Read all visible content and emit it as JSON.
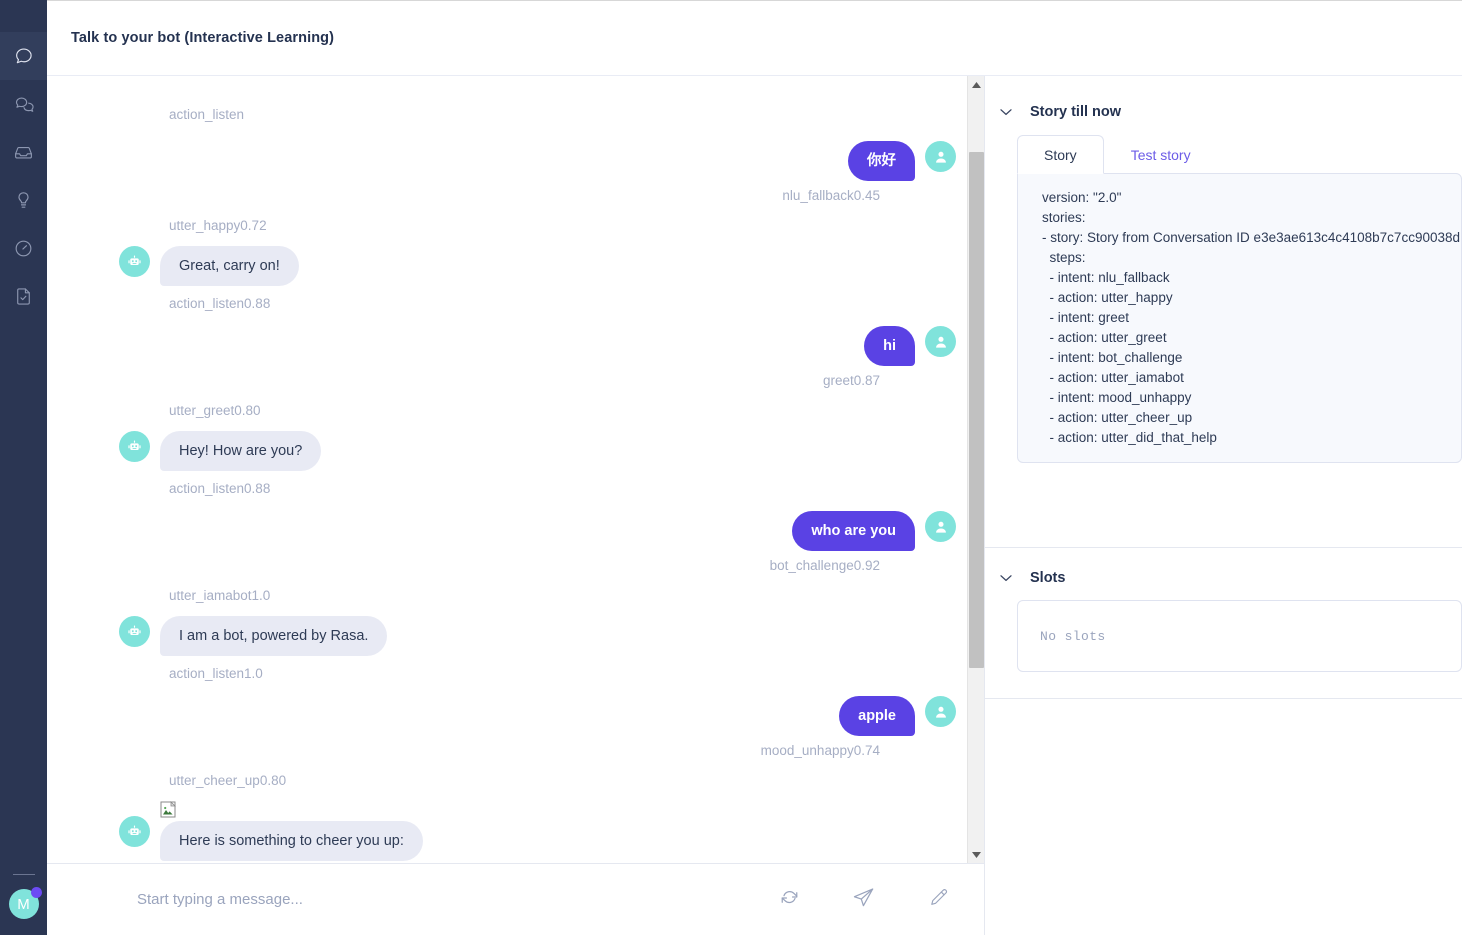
{
  "sidebar": {
    "items": [
      {
        "icon": "chat-bubble-icon",
        "name": "sidebar-item-talk-to-bot",
        "active": true
      },
      {
        "icon": "conversations-icon",
        "name": "sidebar-item-conversations",
        "active": false
      },
      {
        "icon": "inbox-icon",
        "name": "sidebar-item-inbox",
        "active": false
      },
      {
        "icon": "lightbulb-icon",
        "name": "sidebar-item-nlu-insights",
        "active": false
      },
      {
        "icon": "gauge-icon",
        "name": "sidebar-item-analytics",
        "active": false
      },
      {
        "icon": "document-check-icon",
        "name": "sidebar-item-training",
        "active": false
      }
    ],
    "avatar_initial": "M"
  },
  "header": {
    "title": "Talk to your bot (Interactive Learning)"
  },
  "chat": {
    "events": [
      {
        "type": "label",
        "align": "left",
        "text": "action_listen"
      },
      {
        "type": "message",
        "sender": "user",
        "text": "你好",
        "label": "nlu_fallback0.45"
      },
      {
        "type": "label",
        "align": "left",
        "text": "utter_happy0.72"
      },
      {
        "type": "message",
        "sender": "bot",
        "text": "Great, carry on!",
        "label": "action_listen0.88"
      },
      {
        "type": "message",
        "sender": "user",
        "text": "hi",
        "label": "greet0.87"
      },
      {
        "type": "label",
        "align": "left",
        "text": "utter_greet0.80"
      },
      {
        "type": "message",
        "sender": "bot",
        "text": "Hey! How are you?",
        "label": "action_listen0.88"
      },
      {
        "type": "message",
        "sender": "user",
        "text": "who are you",
        "label": "bot_challenge0.92"
      },
      {
        "type": "label",
        "align": "left",
        "text": "utter_iamabot1.0"
      },
      {
        "type": "message",
        "sender": "bot",
        "text": "I am a bot, powered by Rasa.",
        "label": "action_listen1.0"
      },
      {
        "type": "message",
        "sender": "user",
        "text": "apple",
        "label": "mood_unhappy0.74"
      },
      {
        "type": "label",
        "align": "left",
        "text": "utter_cheer_up0.80"
      },
      {
        "type": "message",
        "sender": "bot",
        "text": "Here is something to cheer you up:",
        "broken_image": true
      }
    ],
    "labels": {
      "action_listen": "action_listen",
      "nlu_fallback": "nlu_fallback0.45",
      "utter_happy": "utter_happy0.72",
      "action_listen_088_a": "action_listen0.88",
      "greet": "greet0.87",
      "utter_greet": "utter_greet0.80",
      "action_listen_088_b": "action_listen0.88",
      "bot_challenge": "bot_challenge0.92",
      "utter_iamabot": "utter_iamabot1.0",
      "action_listen_10": "action_listen1.0",
      "mood_unhappy": "mood_unhappy0.74",
      "utter_cheer_up": "utter_cheer_up0.80"
    },
    "messages": {
      "m1": "你好",
      "m2": "Great, carry on!",
      "m3": "hi",
      "m4": "Hey! How are you?",
      "m5": "who are you",
      "m6": "I am a bot, powered by Rasa.",
      "m7": "apple",
      "m8": "Here is something to cheer you up:"
    }
  },
  "composer": {
    "placeholder": "Start typing a message...",
    "value": "",
    "actions": [
      {
        "name": "restart-button",
        "icon": "refresh-icon"
      },
      {
        "name": "send-button",
        "icon": "send-icon"
      },
      {
        "name": "edit-button",
        "icon": "pencil-icon"
      }
    ]
  },
  "right_panel": {
    "story_section": {
      "title": "Story till now",
      "tabs": [
        {
          "label": "Story",
          "active": true
        },
        {
          "label": "Test story",
          "active": false
        }
      ],
      "story_lines": [
        "version: \"2.0\"",
        "stories:",
        "- story: Story from Conversation ID e3e3ae613c4c4108b7c7cc90038d",
        "  steps:",
        "  - intent: nlu_fallback",
        "  - action: utter_happy",
        "  - intent: greet",
        "  - action: utter_greet",
        "  - intent: bot_challenge",
        "  - action: utter_iamabot",
        "  - intent: mood_unhappy",
        "  - action: utter_cheer_up",
        "  - action: utter_did_that_help"
      ]
    },
    "slots_section": {
      "title": "Slots",
      "empty_text": "No slots"
    }
  },
  "colors": {
    "rail_bg": "#2b3653",
    "rail_active": "#323e5c",
    "user_bubble": "#5a42e4",
    "bot_bubble": "#e8eaf4",
    "avatar_teal": "#80e3db",
    "accent_purple": "#6c5ce7",
    "label_grey": "#a6aec4",
    "title_navy": "#243250"
  }
}
